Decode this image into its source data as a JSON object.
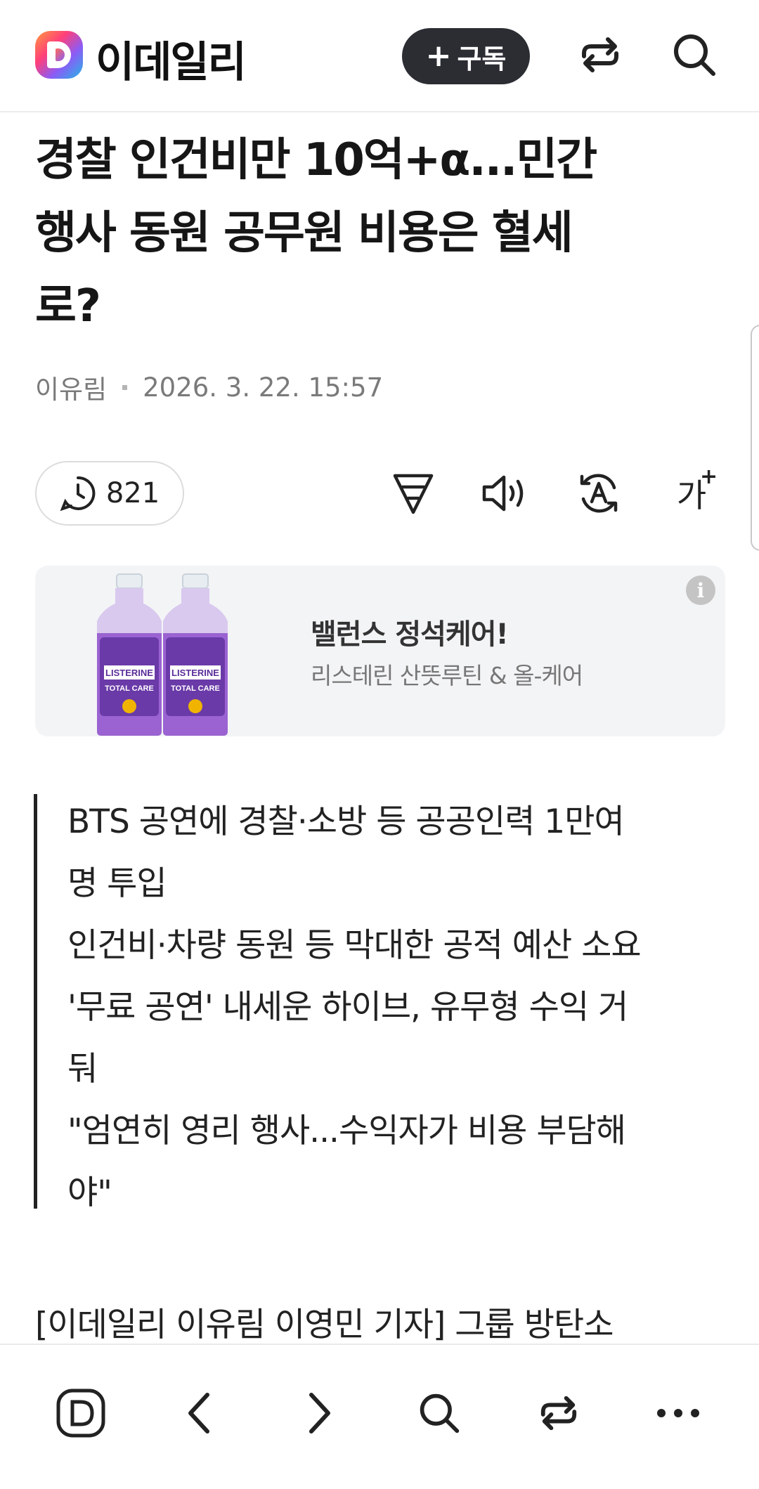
{
  "header": {
    "brand": "이데일리",
    "subscribe_plus": "+",
    "subscribe_label": "구독",
    "share_icon": "share-icon",
    "search_icon": "search-icon"
  },
  "article": {
    "title_lines": [
      "경찰 인건비만 10억+α...민간",
      "행사 동원 공무원 비용은 혈세",
      "로?"
    ],
    "author": "이유림",
    "date": "2026. 3. 22. 15:57",
    "views": "821",
    "summary": [
      "BTS 공연에 경찰·소방 등 공공인력 1만여",
      "명 투입",
      "인건비·차량 동원 등 막대한 공적 예산 소요",
      "'무료 공연' 내세운 하이브, 유무형 수익 거",
      "둬",
      "\"엄연히 영리 행사...수익자가 비용 부담해",
      "야\""
    ],
    "body_first_line": "[이데일리 이유림 이영민 기자] 그룹 방탄소"
  },
  "toolbar": {
    "font_size_label": "가",
    "font_size_plus": "+",
    "icons": [
      "filter-icon",
      "speaker-icon",
      "translate-icon",
      "font-size-icon"
    ]
  },
  "ad": {
    "title": "밸런스 정석케어!",
    "subtitle": "리스테린 산뜻루틴 & 올-케어",
    "info": "i",
    "product_brand": "LISTERINE",
    "product_line": "TOTAL CARE",
    "colors": {
      "liquid": "#8e59c7",
      "label": "#6a3aa8",
      "background": "#f3f4f6"
    }
  },
  "bottom_nav": {
    "items": [
      "home-logo-icon",
      "back-icon",
      "forward-icon",
      "search-icon",
      "share-icon",
      "more-icon"
    ]
  }
}
